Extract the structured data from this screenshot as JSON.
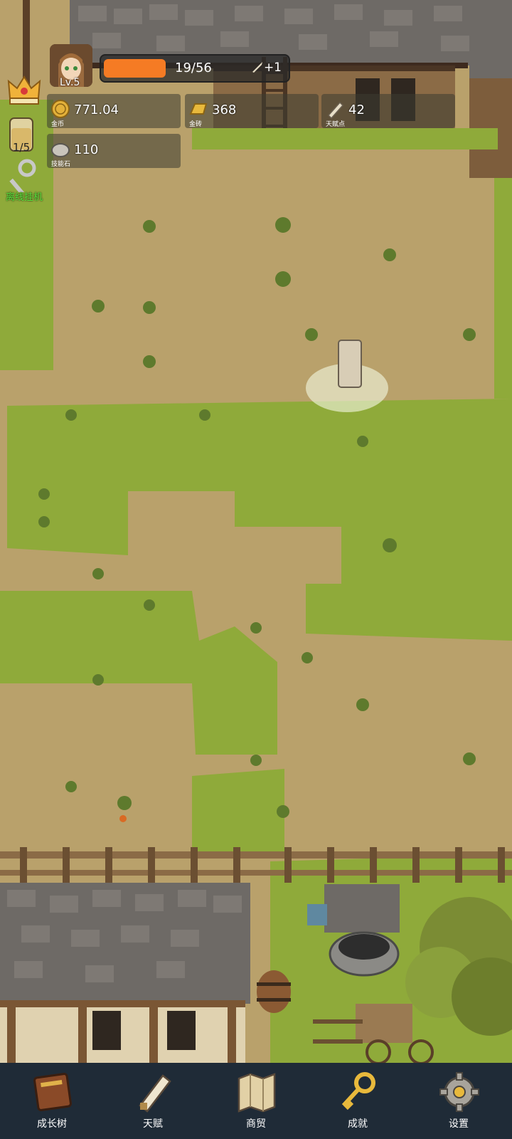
{
  "player": {
    "level_label": "Lv.5",
    "xp_text": "19/56",
    "xp_fraction": 0.34,
    "xp_bonus": "+1"
  },
  "resources": {
    "gold": {
      "value": "771.04",
      "label": "金币"
    },
    "gold_bar": {
      "value": "368",
      "label": "金砖"
    },
    "talent_points": {
      "value": "42",
      "label": "天赋点"
    },
    "skill_stone": {
      "value": "110",
      "label": "技能石"
    }
  },
  "side": {
    "potion_count": "1/5",
    "idle_label": "离线挂机"
  },
  "nav": [
    {
      "label": "成长树",
      "icon": "book-icon"
    },
    {
      "label": "天赋",
      "icon": "scroll-icon"
    },
    {
      "label": "商贸",
      "icon": "map-icon"
    },
    {
      "label": "成就",
      "icon": "key-icon"
    },
    {
      "label": "设置",
      "icon": "gear-icon"
    }
  ],
  "colors": {
    "xp_fill": "#f57b24",
    "idle_label": "#57e03c",
    "nav_bg": "#1f2b37"
  }
}
